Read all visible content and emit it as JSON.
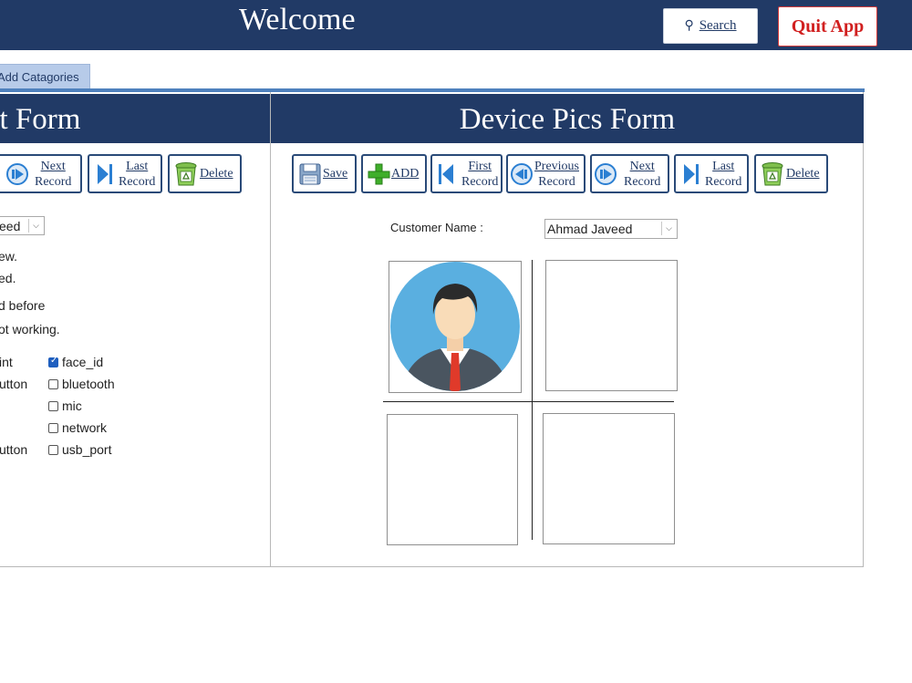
{
  "header": {
    "title": "Welcome",
    "search_label": "Search",
    "quit_label": "Quit App"
  },
  "tabs": [
    {
      "label": "Add Catagories"
    }
  ],
  "left_form": {
    "title": "est Form",
    "buttons": {
      "next_line1": "Next",
      "next_line2": "Record",
      "last_line1": "Last",
      "last_line2": "Record",
      "delete": "Delete"
    },
    "customer_value": "eed",
    "lines": [
      "ew.",
      "ed.",
      "d before",
      "ot working."
    ],
    "left_labels": [
      "int",
      "utton",
      "utton"
    ],
    "checkboxes": [
      {
        "label": "face_id",
        "checked": true
      },
      {
        "label": "bluetooth",
        "checked": false
      },
      {
        "label": "mic",
        "checked": false
      },
      {
        "label": "network",
        "checked": false
      },
      {
        "label": "usb_port",
        "checked": false
      }
    ]
  },
  "right_form": {
    "title": "Device Pics Form",
    "buttons": {
      "save": "Save",
      "add": "ADD",
      "first_line1": "First",
      "first_line2": "Record",
      "prev_line1": "Previous",
      "prev_line2": "Record",
      "next_line1": "Next",
      "next_line2": "Record",
      "last_line1": "Last",
      "last_line2": "Record",
      "delete": "Delete"
    },
    "customer_label": "Customer Name :",
    "customer_value": "Ahmad Javeed"
  },
  "colors": {
    "header_bg": "#213a66",
    "accent": "#4f81bd",
    "quit_red": "#d11f1f",
    "tab_bg": "#b7cbe9"
  }
}
